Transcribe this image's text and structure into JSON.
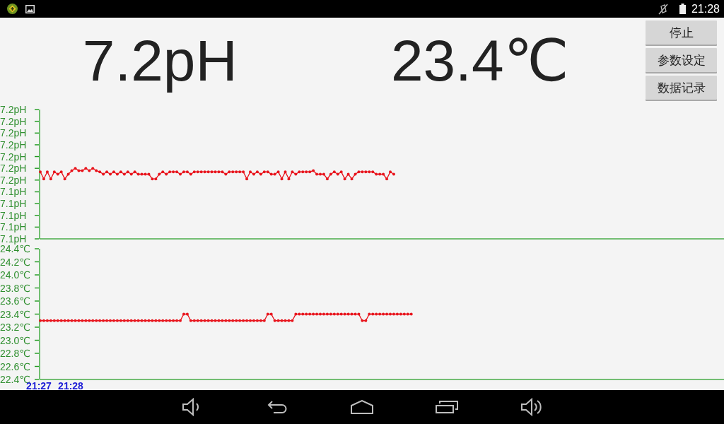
{
  "status_bar": {
    "time": "21:28"
  },
  "readings": [
    "7.2pH",
    "23.4℃"
  ],
  "buttons": [
    "停止",
    "参数设定",
    "数据记录"
  ],
  "charts": [
    {
      "chart_data": {
        "type": "line",
        "ylim": [
          7.1,
          7.21
        ],
        "yticks": [
          {
            "value": 7.1,
            "label": "7.1pH"
          },
          {
            "value": 7.11,
            "label": "7.1pH"
          },
          {
            "value": 7.12,
            "label": "7.1pH"
          },
          {
            "value": 7.13,
            "label": "7.1pH"
          },
          {
            "value": 7.14,
            "label": "7.1pH"
          },
          {
            "value": 7.15,
            "label": "7.2pH"
          },
          {
            "value": 7.16,
            "label": "7.2pH"
          },
          {
            "value": 7.17,
            "label": "7.2pH"
          },
          {
            "value": 7.18,
            "label": "7.2pH"
          },
          {
            "value": 7.19,
            "label": "7.2pH"
          },
          {
            "value": 7.2,
            "label": "7.2pH"
          },
          {
            "value": 7.21,
            "label": "7.2pH"
          }
        ],
        "series": [
          {
            "color": "#e8141c",
            "values": [
              7.157,
              7.151,
              7.157,
              7.151,
              7.157,
              7.155,
              7.157,
              7.151,
              7.155,
              7.158,
              7.16,
              7.158,
              7.158,
              7.16,
              7.158,
              7.16,
              7.158,
              7.157,
              7.155,
              7.157,
              7.155,
              7.157,
              7.155,
              7.157,
              7.155,
              7.157,
              7.155,
              7.157,
              7.155,
              7.155,
              7.155,
              7.155,
              7.151,
              7.151,
              7.155,
              7.157,
              7.155,
              7.157,
              7.157,
              7.157,
              7.155,
              7.157,
              7.157,
              7.155,
              7.157,
              7.157,
              7.157,
              7.157,
              7.157,
              7.157,
              7.157,
              7.157,
              7.157,
              7.155,
              7.157,
              7.157,
              7.157,
              7.157,
              7.157,
              7.151,
              7.157,
              7.155,
              7.157,
              7.155,
              7.157,
              7.157,
              7.155,
              7.155,
              7.157,
              7.151,
              7.157,
              7.151,
              7.157,
              7.155,
              7.157,
              7.157,
              7.157,
              7.157,
              7.158,
              7.155,
              7.155,
              7.155,
              7.151,
              7.155,
              7.157,
              7.155,
              7.157,
              7.151,
              7.155,
              7.151,
              7.155,
              7.157,
              7.157,
              7.157,
              7.157,
              7.157,
              7.155,
              7.155,
              7.155,
              7.151,
              7.157,
              7.155
            ]
          }
        ]
      }
    },
    {
      "chart_data": {
        "type": "line",
        "ylim": [
          22.4,
          24.4
        ],
        "yticks": [
          {
            "value": 22.4,
            "label": "22.4℃"
          },
          {
            "value": 22.6,
            "label": "22.6℃"
          },
          {
            "value": 22.8,
            "label": "22.8℃"
          },
          {
            "value": 23.0,
            "label": "23.0℃"
          },
          {
            "value": 23.2,
            "label": "23.2℃"
          },
          {
            "value": 23.4,
            "label": "23.4℃"
          },
          {
            "value": 23.6,
            "label": "23.6℃"
          },
          {
            "value": 23.8,
            "label": "23.8℃"
          },
          {
            "value": 24.0,
            "label": "24.0℃"
          },
          {
            "value": 24.2,
            "label": "24.2℃"
          },
          {
            "value": 24.4,
            "label": "24.4℃"
          }
        ],
        "series": [
          {
            "color": "#e8141c",
            "values": [
              23.3,
              23.3,
              23.3,
              23.3,
              23.3,
              23.3,
              23.3,
              23.3,
              23.3,
              23.3,
              23.3,
              23.3,
              23.3,
              23.3,
              23.3,
              23.3,
              23.3,
              23.3,
              23.3,
              23.3,
              23.3,
              23.3,
              23.3,
              23.3,
              23.3,
              23.3,
              23.3,
              23.3,
              23.3,
              23.3,
              23.3,
              23.3,
              23.3,
              23.3,
              23.3,
              23.3,
              23.3,
              23.3,
              23.3,
              23.3,
              23.3,
              23.4,
              23.4,
              23.3,
              23.3,
              23.3,
              23.3,
              23.3,
              23.3,
              23.3,
              23.3,
              23.3,
              23.3,
              23.3,
              23.3,
              23.3,
              23.3,
              23.3,
              23.3,
              23.3,
              23.3,
              23.3,
              23.3,
              23.3,
              23.3,
              23.4,
              23.4,
              23.3,
              23.3,
              23.3,
              23.3,
              23.3,
              23.3,
              23.4,
              23.4,
              23.4,
              23.4,
              23.4,
              23.4,
              23.4,
              23.4,
              23.4,
              23.4,
              23.4,
              23.4,
              23.4,
              23.4,
              23.4,
              23.4,
              23.4,
              23.4,
              23.4,
              23.3,
              23.3,
              23.4,
              23.4,
              23.4,
              23.4,
              23.4,
              23.4,
              23.4,
              23.4,
              23.4,
              23.4,
              23.4,
              23.4,
              23.4
            ]
          }
        ]
      },
      "time_labels": [
        "21:27",
        "21:28"
      ]
    }
  ]
}
